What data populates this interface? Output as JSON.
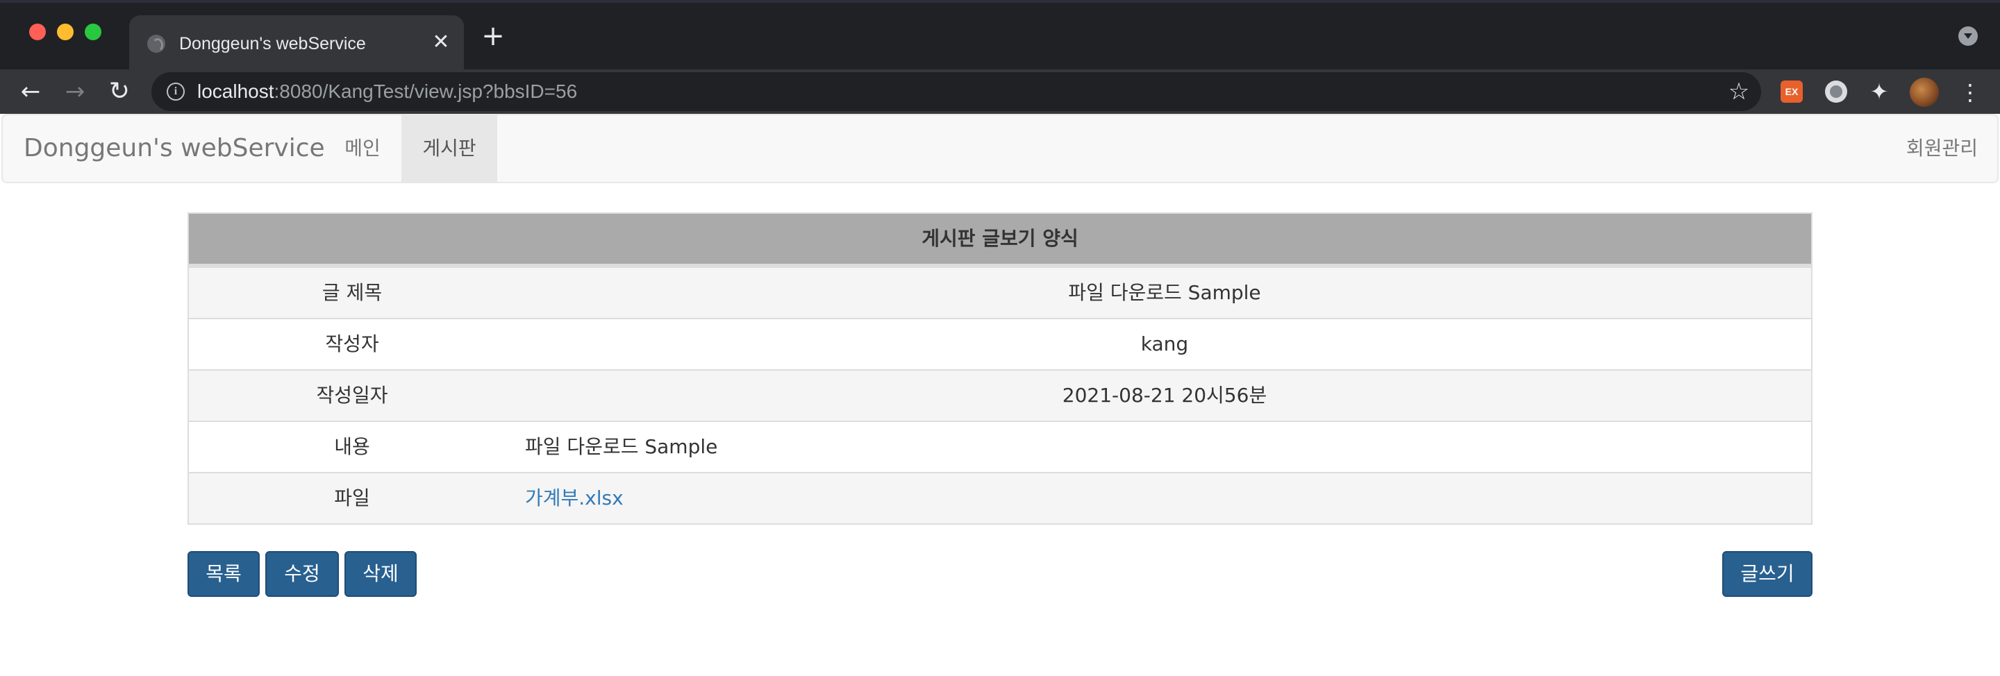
{
  "browser": {
    "tab_title": "Donggeun's webService",
    "tab_close": "✕",
    "new_tab": "+",
    "url_host": "localhost",
    "url_rest": ":8080/KangTest/view.jsp?bbsID=56",
    "extension_ex_label": "EX"
  },
  "navbar": {
    "brand": "Donggeun's webService",
    "items": [
      {
        "label": "메인",
        "active": false
      },
      {
        "label": "게시판",
        "active": true
      }
    ],
    "right_item": "회원관리"
  },
  "board": {
    "heading": "게시판 글보기 양식",
    "rows": [
      {
        "label": "글 제목",
        "value": "파일 다운로드 Sample"
      },
      {
        "label": "작성자",
        "value": "kang"
      },
      {
        "label": "작성일자",
        "value": "2021-08-21 20시56분"
      },
      {
        "label": "내용",
        "value": "파일 다운로드 Sample"
      },
      {
        "label": "파일",
        "value": "가계부.xlsx"
      }
    ]
  },
  "buttons": {
    "list": "목록",
    "edit": "수정",
    "delete": "삭제",
    "write": "글쓰기"
  },
  "colors": {
    "primary_button": "#286090",
    "table_header": "#aaaaaa",
    "link": "#337ab7"
  }
}
